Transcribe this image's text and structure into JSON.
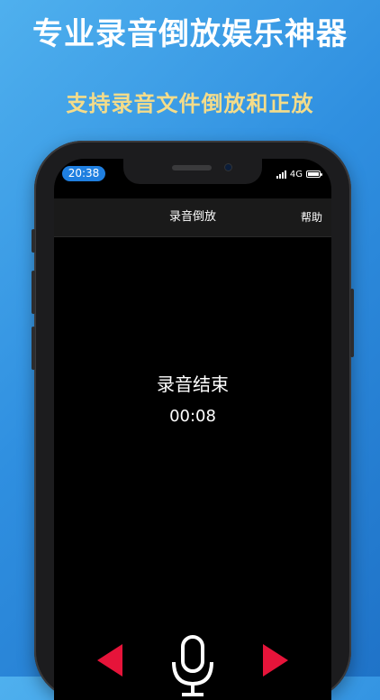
{
  "promo": {
    "headline": "专业录音倒放娱乐神器",
    "subline": "支持录音文件倒放和正放"
  },
  "status_bar": {
    "time": "20:38",
    "network": "4G"
  },
  "nav": {
    "title": "录音倒放",
    "help_label": "帮助"
  },
  "recording": {
    "status_text": "录音结束",
    "elapsed": "00:08"
  },
  "controls": {
    "left_icon": "play-reverse-icon",
    "center_icon": "microphone-icon",
    "right_icon": "play-forward-icon"
  },
  "colors": {
    "accent_red": "#e6143a",
    "time_pill": "#1f7fe0",
    "subline": "#f4dc8a"
  }
}
